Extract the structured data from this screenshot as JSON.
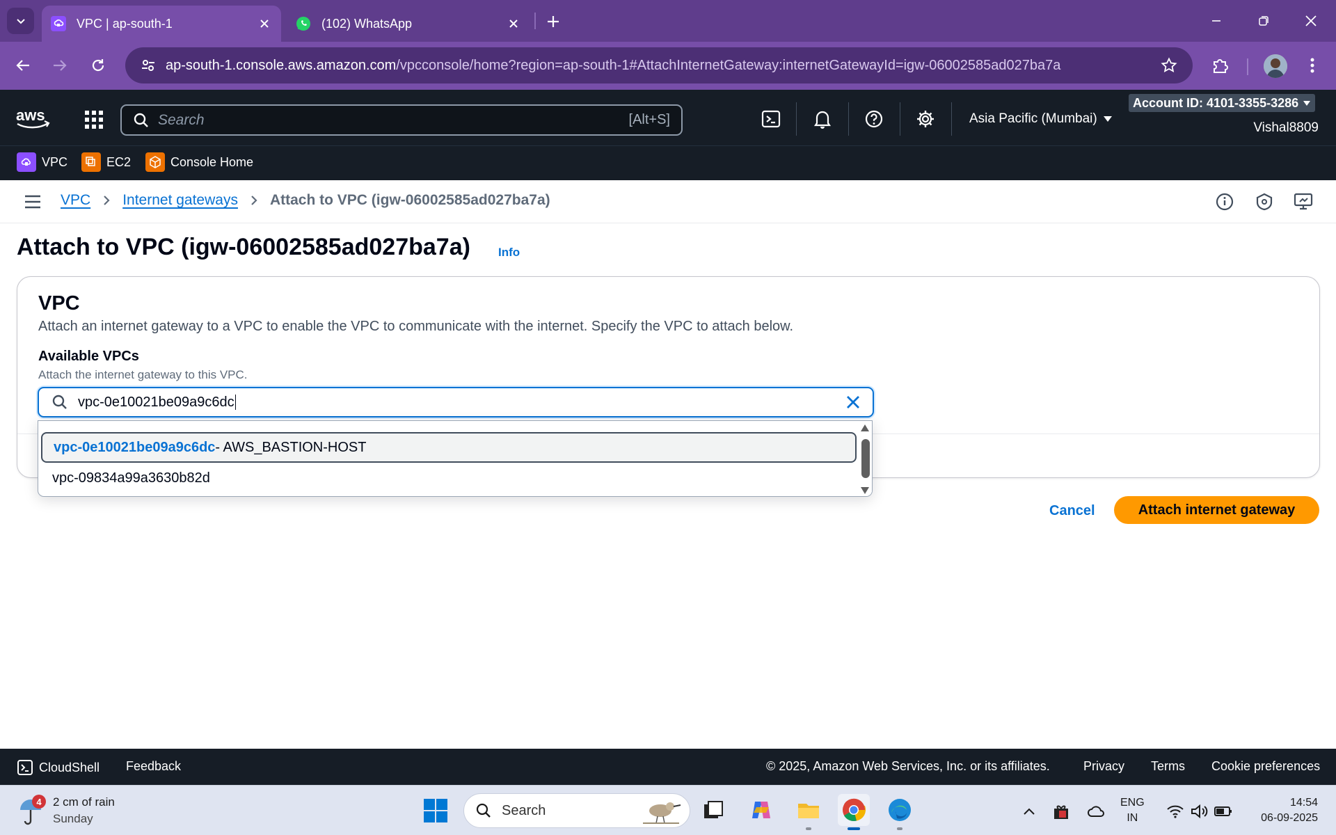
{
  "browser": {
    "tabs": [
      {
        "title": "VPC | ap-south-1",
        "active": true
      },
      {
        "title": "(102) WhatsApp",
        "active": false
      }
    ],
    "url_host": "ap-south-1.console.aws.amazon.com",
    "url_path": "/vpcconsole/home?region=ap-south-1#AttachInternetGateway:internetGatewayId=igw-06002585ad027ba7a"
  },
  "aws_nav": {
    "search_placeholder": "Search",
    "search_shortcut": "[Alt+S]",
    "region": "Asia Pacific (Mumbai)",
    "account_id": "Account ID: 4101-3355-3286",
    "username": "Vishal8809"
  },
  "favorites": [
    {
      "label": "VPC",
      "color": "#8c4fff"
    },
    {
      "label": "EC2",
      "color": "#ed7100"
    },
    {
      "label": "Console Home",
      "color": "#ed7100"
    }
  ],
  "breadcrumb": {
    "items": [
      "VPC",
      "Internet gateways"
    ],
    "current": "Attach to VPC (igw-06002585ad027ba7a)"
  },
  "page": {
    "title": "Attach to VPC (igw-06002585ad027ba7a)",
    "info_label": "Info",
    "container_title": "VPC",
    "container_description": "Attach an internet gateway to a VPC to enable the VPC to communicate with the internet. Specify the VPC to attach below.",
    "field_label": "Available VPCs",
    "field_description": "Attach the internet gateway to this VPC.",
    "input_value": "vpc-0e10021be09a9c6dc",
    "options": [
      {
        "match": "vpc-0e10021be09a9c6dc",
        "rest": " - AWS_BASTION-HOST",
        "highlighted": true
      },
      {
        "match": "",
        "rest": "vpc-09834a99a3630b82d",
        "highlighted": false
      }
    ],
    "cancel_label": "Cancel",
    "submit_label": "Attach internet gateway",
    "accent_color": "#0972d3",
    "primary_color": "#ff9900"
  },
  "footer": {
    "cloudshell": "CloudShell",
    "feedback": "Feedback",
    "copyright": "© 2025, Amazon Web Services, Inc. or its affiliates.",
    "links": [
      "Privacy",
      "Terms",
      "Cookie preferences"
    ]
  },
  "taskbar": {
    "weather_badge": "4",
    "weather_line1": "2 cm of rain",
    "weather_line2": "Sunday",
    "search_placeholder": "Search",
    "lang_line1": "ENG",
    "lang_line2": "IN",
    "time": "14:54",
    "date": "06-09-2025"
  }
}
